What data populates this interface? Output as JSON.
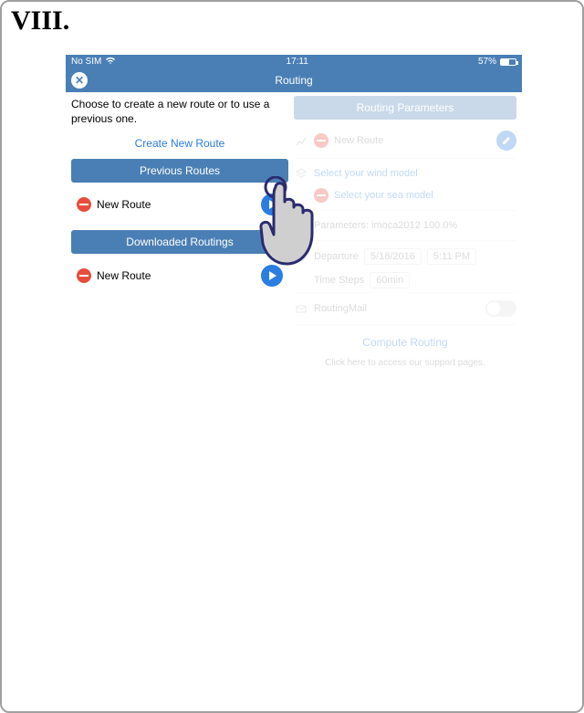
{
  "figure_label": "VIII.",
  "status": {
    "carrier": "No SIM",
    "time": "17:11",
    "battery_pct": "57%"
  },
  "navbar": {
    "title": "Routing",
    "close_label": "✕"
  },
  "left": {
    "prompt": "Choose to create a new route or to use a previous one.",
    "create_link": "Create New Route",
    "prev_header": "Previous Routes",
    "prev_item": "New Route",
    "dl_header": "Downloaded Routings",
    "dl_item": "New Route"
  },
  "right": {
    "header": "Routing Parameters",
    "newroute_label": "New Route",
    "wind_placeholder": "Select your wind model",
    "sea_placeholder": "Select your sea model",
    "params_label": "Parameters: imoca2012 100.0%",
    "depart_label": "Departure",
    "depart_date": "5/18/2016",
    "depart_time": "5:11 PM",
    "timesteps_label": "Time Steps",
    "timesteps_value": "60min",
    "routingmail_label": "RoutingMail",
    "compute_link": "Compute Routing",
    "support_link": "Click here to access our support pages."
  }
}
